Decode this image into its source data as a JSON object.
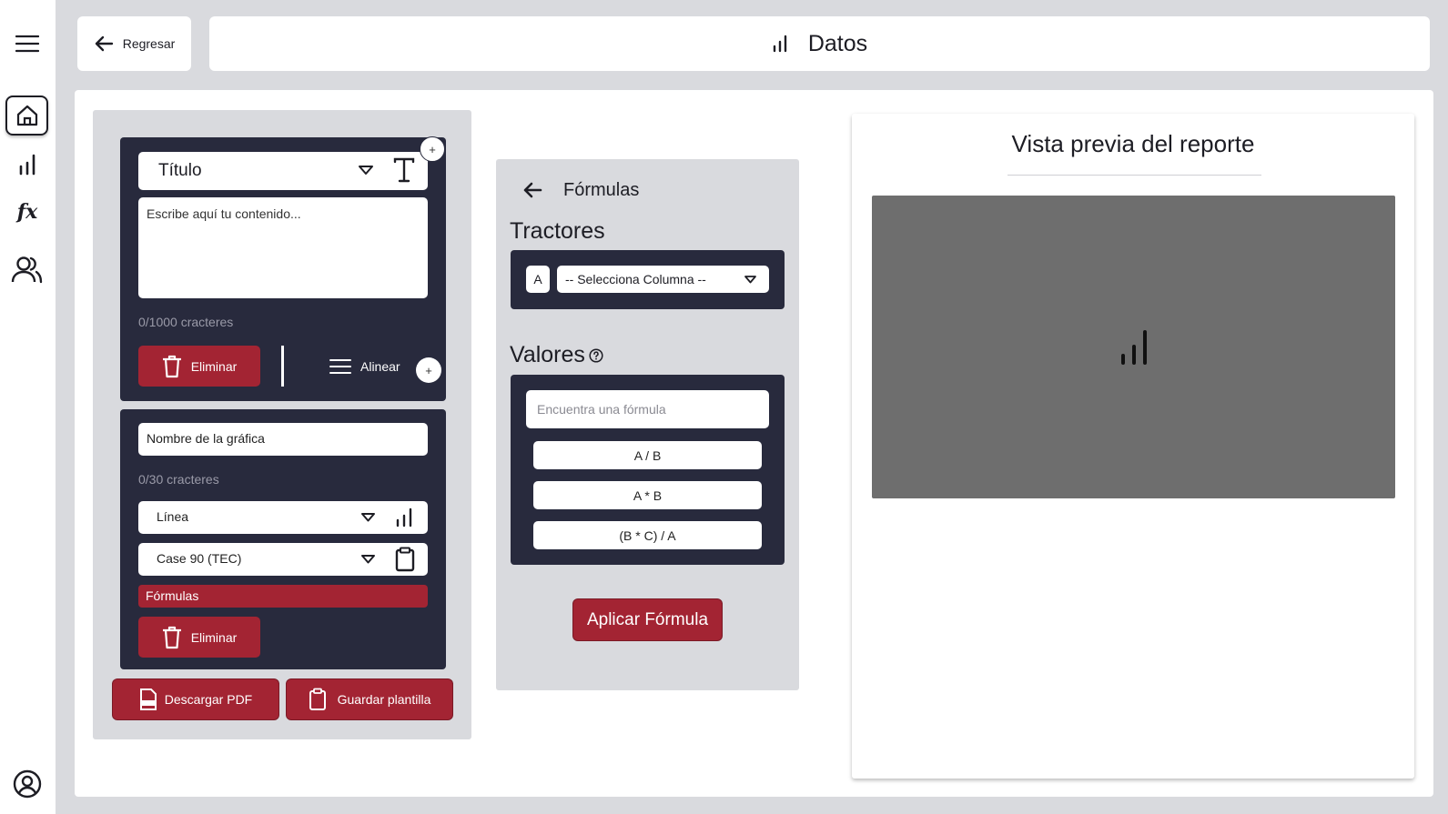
{
  "header": {
    "back_label": "Regresar",
    "title": "Datos",
    "title_icon": "bar-chart-icon"
  },
  "sidebar": {
    "items": [
      {
        "name": "home",
        "icon": "home-icon"
      },
      {
        "name": "charts",
        "icon": "bar-chart-icon"
      },
      {
        "name": "formulas",
        "icon": "function-fx-icon"
      },
      {
        "name": "users",
        "icon": "users-icon"
      }
    ],
    "account_icon": "user-circle-icon"
  },
  "editor": {
    "text_block": {
      "type_select": "Título",
      "textarea_placeholder": "Escribe aquí tu contenido...",
      "char_count": "0/1000 cracteres",
      "delete_label": "Eliminar",
      "align_label": "Alinear",
      "add_symbol": "+"
    },
    "chart_block": {
      "name_placeholder": "Nombre de la gráfica",
      "char_count": "0/30 cracteres",
      "chart_type_select": "Línea",
      "source_select": "Case 90 (TEC)",
      "formulas_label": "Fórmulas",
      "delete_label": "Eliminar"
    },
    "download_pdf_label": "Descargar PDF",
    "save_template_label": "Guardar plantilla"
  },
  "formulas_panel": {
    "title": "Fórmulas",
    "tractores_heading": "Tractores",
    "column_badge": "A",
    "column_select": "-- Selecciona Columna --",
    "valores_heading": "Valores",
    "search_placeholder": "Encuentra una fórmula",
    "formulas": [
      "A / B",
      "A * B",
      "(B * C) / A"
    ],
    "apply_label": "Aplicar Fórmula"
  },
  "preview": {
    "title": "Vista previa del reporte"
  },
  "colors": {
    "accent_red": "#a32433",
    "dark_panel": "#282a3d",
    "page_bg": "#d9dade",
    "preview_gray": "#6e6e6e"
  }
}
